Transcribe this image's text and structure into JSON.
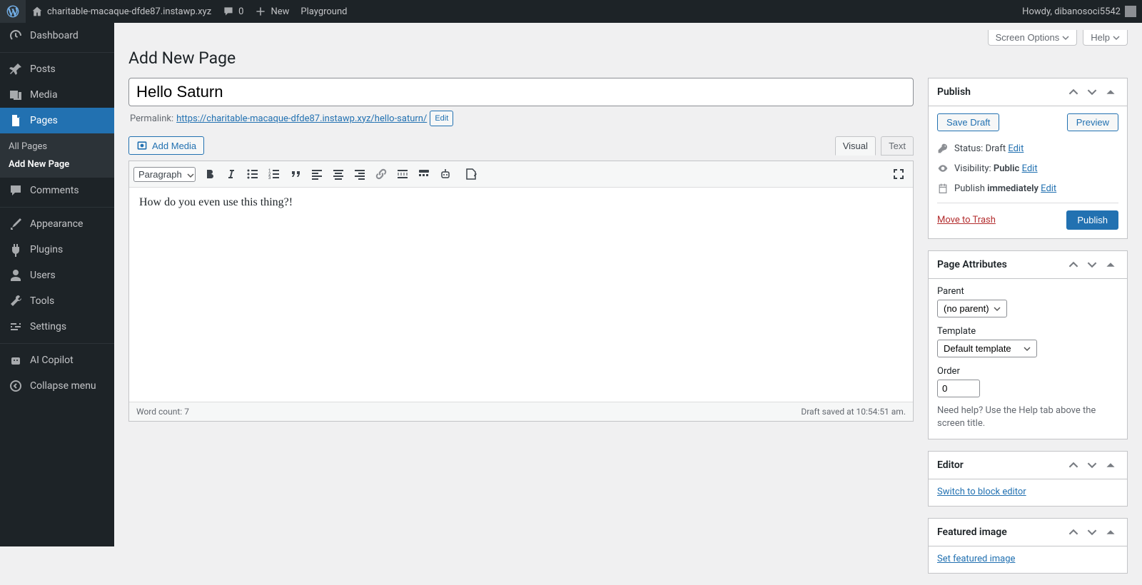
{
  "adminbar": {
    "site_name": "charitable-macaque-dfde87.instawp.xyz",
    "comments_count": "0",
    "new_label": "New",
    "playground_label": "Playground",
    "howdy": "Howdy, dibanosoci5542"
  },
  "menu": {
    "dashboard": "Dashboard",
    "posts": "Posts",
    "media": "Media",
    "pages": "Pages",
    "pages_submenu": {
      "all": "All Pages",
      "add": "Add New Page"
    },
    "comments": "Comments",
    "appearance": "Appearance",
    "plugins": "Plugins",
    "users": "Users",
    "tools": "Tools",
    "settings": "Settings",
    "ai_copilot": "AI Copilot",
    "collapse": "Collapse menu"
  },
  "screen": {
    "options": "Screen Options",
    "help": "Help"
  },
  "page": {
    "heading": "Add New Page",
    "title_value": "Hello Saturn",
    "permalink_label": "Permalink:",
    "permalink_base": "https://charitable-macaque-dfde87.instawp.xyz/",
    "permalink_slug": "hello-saturn/",
    "edit_btn": "Edit",
    "add_media": "Add Media",
    "tab_visual": "Visual",
    "tab_text": "Text",
    "format_sel": "Paragraph",
    "content": "How do you even use this thing?!",
    "word_count_label": "Word count:",
    "word_count": "7",
    "draft_notice": "Draft saved at 10:54:51 am."
  },
  "publish": {
    "box_title": "Publish",
    "save_draft": "Save Draft",
    "preview": "Preview",
    "status_label": "Status:",
    "status_value": "Draft",
    "visibility_label": "Visibility:",
    "visibility_value": "Public",
    "publish_label": "Publish",
    "publish_value": "immediately",
    "edit_link": "Edit",
    "trash": "Move to Trash",
    "publish_btn": "Publish"
  },
  "attributes": {
    "box_title": "Page Attributes",
    "parent_label": "Parent",
    "parent_value": "(no parent)",
    "template_label": "Template",
    "template_value": "Default template",
    "order_label": "Order",
    "order_value": "0",
    "help": "Need help? Use the Help tab above the screen title."
  },
  "editor_box": {
    "box_title": "Editor",
    "switch_link": "Switch to block editor"
  },
  "featured": {
    "box_title": "Featured image",
    "set_link": "Set featured image"
  }
}
